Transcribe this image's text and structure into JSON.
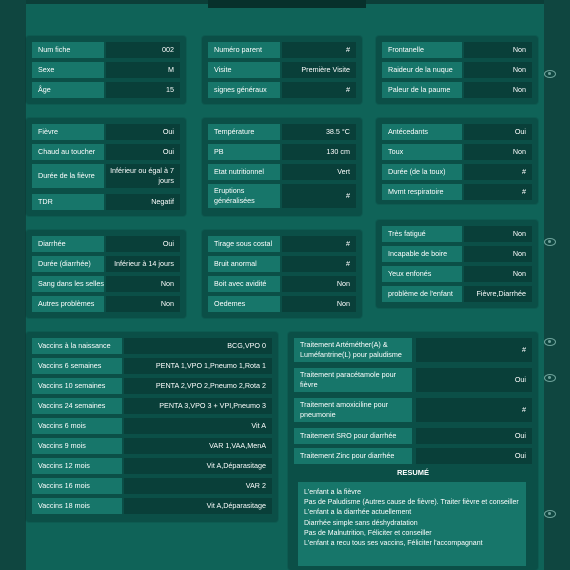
{
  "card1": [
    {
      "label": "Num fiche",
      "value": "002"
    },
    {
      "label": "Sexe",
      "value": "M"
    },
    {
      "label": "Âge",
      "value": "15"
    }
  ],
  "card2": [
    {
      "label": "Numéro parent",
      "value": "#"
    },
    {
      "label": "Visite",
      "value": "Première Visite"
    },
    {
      "label": "signes généraux",
      "value": "#"
    }
  ],
  "card3": [
    {
      "label": "Frontanelle",
      "value": "Non"
    },
    {
      "label": "Raideur de la nuque",
      "value": "Non"
    },
    {
      "label": "Paleur de la paume",
      "value": "Non"
    }
  ],
  "card4": [
    {
      "label": "Fièvre",
      "value": "Oui"
    },
    {
      "label": "Chaud au toucher",
      "value": "Oui"
    },
    {
      "label": "Durée de la fièvre",
      "value": "Inférieur ou égal à 7 jours"
    },
    {
      "label": "TDR",
      "value": "Negatif"
    }
  ],
  "card5": [
    {
      "label": "Température",
      "value": "38.5 °C"
    },
    {
      "label": "PB",
      "value": "130 cm"
    },
    {
      "label": "Etat nutritionnel",
      "value": "Vert"
    },
    {
      "label": "Eruptions généralisées",
      "value": "#"
    }
  ],
  "card6": [
    {
      "label": "Antécedants",
      "value": "Oui"
    },
    {
      "label": "Toux",
      "value": "Non"
    },
    {
      "label": "Durée (de la toux)",
      "value": "#"
    },
    {
      "label": "Mvmt respiratoire",
      "value": "#"
    }
  ],
  "card7": [
    {
      "label": "Diarrhée",
      "value": "Oui"
    },
    {
      "label": "Durée (diarrhée)",
      "value": "Inférieur à 14 jours"
    },
    {
      "label": "Sang dans les selles",
      "value": "Non"
    },
    {
      "label": "Autres problèmes",
      "value": "Non"
    }
  ],
  "card8": [
    {
      "label": "Tirage sous costal",
      "value": "#"
    },
    {
      "label": "Bruit anormal",
      "value": "#"
    },
    {
      "label": "Boit avec avidité",
      "value": "Non"
    },
    {
      "label": "Oedemes",
      "value": "Non"
    }
  ],
  "card9": [
    {
      "label": "Très fatigué",
      "value": "Non"
    },
    {
      "label": "Incapable de boire",
      "value": "Non"
    },
    {
      "label": "Yeux enfonés",
      "value": "Non"
    },
    {
      "label": "problème de l'enfant",
      "value": "Fièvre,Diarrhée"
    }
  ],
  "vaccins": [
    {
      "label": "Vaccins à la naissance",
      "value": "BCG,VPO 0"
    },
    {
      "label": "Vaccins 6 semaines",
      "value": "PENTA 1,VPO 1,Pneumo 1,Rota 1"
    },
    {
      "label": "Vaccins 10 semaines",
      "value": "PENTA 2,VPO 2,Pneumo 2,Rota 2"
    },
    {
      "label": "Vaccins 24 semaines",
      "value": "PENTA 3,VPO 3 + VPI,Pneumo 3"
    },
    {
      "label": "Vaccins 6 mois",
      "value": "Vit A"
    },
    {
      "label": "Vaccins 9 mois",
      "value": "VAR 1,VAA,MenA"
    },
    {
      "label": "Vaccins 12 mois",
      "value": "Vit A,Déparasitage"
    },
    {
      "label": "Vaccins 16 mois",
      "value": "VAR 2"
    },
    {
      "label": "Vaccins 18 mois",
      "value": "Vit A,Déparasitage"
    }
  ],
  "traitements": [
    {
      "label": "Traitement Artéméther(A) & Luméfantrine(L) pour paludisme",
      "value": "#"
    },
    {
      "label": "Traitement paracétamole pour fièvre",
      "value": "Oui"
    },
    {
      "label": "Traitement amoxiciline pour pneumonie",
      "value": "#"
    },
    {
      "label": "Traitement SRO pour diarrhée",
      "value": "Oui"
    },
    {
      "label": "Traitement Zinc pour diarrhée",
      "value": "Oui"
    }
  ],
  "resume": {
    "title": "RESUMÉ",
    "lines": [
      "L'enfant a la fièvre",
      "Pas de Paludisme (Autres cause de fièvre). Traiter fièvre et conseiller",
      "L'enfant a la diarrhée actuellement",
      "Diarrhée simple sans déshydratation",
      "Pas de Malnutrition, Féliciter et conseiller",
      "L'enfant a recu tous ses vaccins, Féliciter l'accompagnant"
    ]
  }
}
